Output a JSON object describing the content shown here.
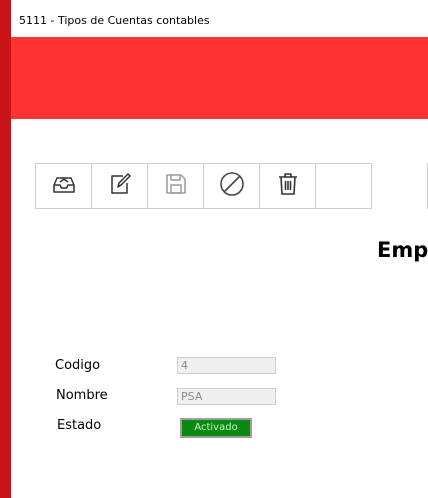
{
  "window": {
    "title": "5111 - Tipos de Cuentas contables"
  },
  "toolbar": {
    "buttons": [
      {
        "icon": "inbox-icon",
        "enabled": true
      },
      {
        "icon": "edit-icon",
        "enabled": true
      },
      {
        "icon": "save-icon",
        "enabled": false
      },
      {
        "icon": "cancel-icon",
        "enabled": true
      },
      {
        "icon": "trash-icon",
        "enabled": true
      }
    ]
  },
  "header": {
    "company": "Emp"
  },
  "form": {
    "codigo": {
      "label": "Codigo",
      "value": "4"
    },
    "nombre": {
      "label": "Nombre",
      "value": "PSA"
    },
    "estado": {
      "label": "Estado",
      "value": "Activado"
    }
  },
  "colors": {
    "banner": "#ff3333",
    "frame": "#c4141a",
    "status_active": "#0a8a10"
  }
}
